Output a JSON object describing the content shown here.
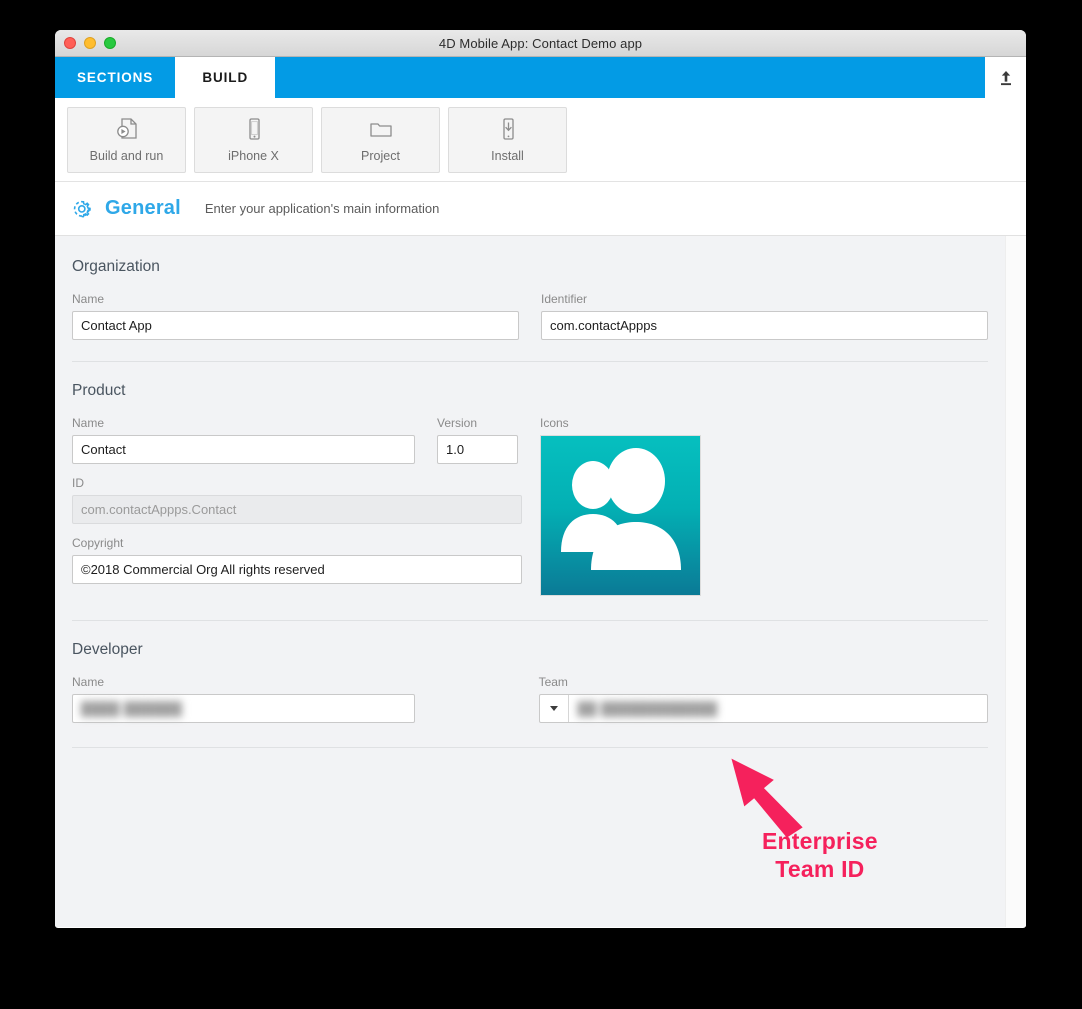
{
  "window": {
    "title": "4D Mobile App: Contact Demo app",
    "traffic_lights": [
      "close",
      "minimize",
      "maximize"
    ]
  },
  "tabs": [
    {
      "label": "SECTIONS",
      "active": false
    },
    {
      "label": "BUILD",
      "active": true
    }
  ],
  "tabbar": {
    "upload_icon": "upload-icon",
    "accent_color": "#039be5"
  },
  "toolbar": {
    "buttons": [
      {
        "label": "Build and run",
        "icon": "build-and-run-icon"
      },
      {
        "label": "iPhone X",
        "icon": "device-icon"
      },
      {
        "label": "Project",
        "icon": "folder-icon"
      },
      {
        "label": "Install",
        "icon": "install-icon"
      }
    ]
  },
  "section_header": {
    "icon": "gear-icon",
    "title": "General",
    "title_color": "#2fa8e8",
    "description": "Enter your application's main information"
  },
  "form": {
    "organization": {
      "group_title": "Organization",
      "name_label": "Name",
      "name_value": "Contact App",
      "identifier_label": "Identifier",
      "identifier_value": "com.contactAppps"
    },
    "product": {
      "group_title": "Product",
      "name_label": "Name",
      "name_value": "Contact",
      "version_label": "Version",
      "version_value": "1.0",
      "icons_label": "Icons",
      "id_label": "ID",
      "id_value": "com.contactAppps.Contact",
      "copyright_label": "Copyright",
      "copyright_value": "©2018 Commercial Org All rights reserved"
    },
    "developer": {
      "group_title": "Developer",
      "name_label": "Name",
      "name_value": "████ ██████",
      "team_label": "Team",
      "team_value": "██ ████████████"
    }
  },
  "annotation": {
    "line1": "Enterprise",
    "line2": "Team ID",
    "color": "#f5215c",
    "arrow": "arrow-up-left-icon"
  }
}
